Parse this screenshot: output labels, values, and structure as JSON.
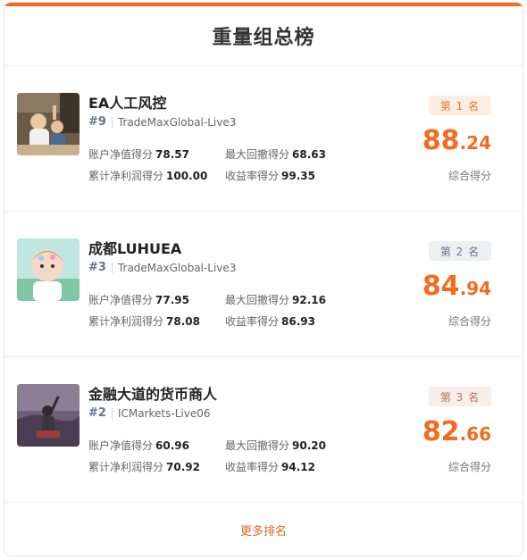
{
  "title": "重量组总榜",
  "entries": [
    {
      "name": "EA人工风控",
      "rank_no": "#9",
      "account": "TradeMaxGlobal-Live3",
      "stats": {
        "net_value_label": "账户净值得分",
        "net_value": "78.57",
        "drawdown_label": "最大回撤得分",
        "drawdown": "68.63",
        "profit_label": "累计净利润得分",
        "profit": "100.00",
        "yield_label": "收益率得分",
        "yield": "99.35"
      },
      "badge": "第 1 名",
      "score_int": "88",
      "score_dec": ".24",
      "score_label": "综合得分"
    },
    {
      "name": "成都LUHUEA",
      "rank_no": "#3",
      "account": "TradeMaxGlobal-Live3",
      "stats": {
        "net_value_label": "账户净值得分",
        "net_value": "77.95",
        "drawdown_label": "最大回撤得分",
        "drawdown": "92.16",
        "profit_label": "累计净利润得分",
        "profit": "78.08",
        "yield_label": "收益率得分",
        "yield": "86.93"
      },
      "badge": "第 2 名",
      "score_int": "84",
      "score_dec": ".94",
      "score_label": "综合得分"
    },
    {
      "name": "金融大道的货币商人",
      "rank_no": "#2",
      "account": "ICMarkets-Live06",
      "stats": {
        "net_value_label": "账户净值得分",
        "net_value": "60.96",
        "drawdown_label": "最大回撤得分",
        "drawdown": "90.20",
        "profit_label": "累计净利润得分",
        "profit": "70.92",
        "yield_label": "收益率得分",
        "yield": "94.12"
      },
      "badge": "第 3 名",
      "score_int": "82",
      "score_dec": ".66",
      "score_label": "综合得分"
    }
  ],
  "more_link": "更多排名",
  "colors": {
    "accent": "#f36b21",
    "rank_gold": "#e07a2e",
    "rank_silver": "#66768a",
    "rank_bronze": "#b57560"
  }
}
